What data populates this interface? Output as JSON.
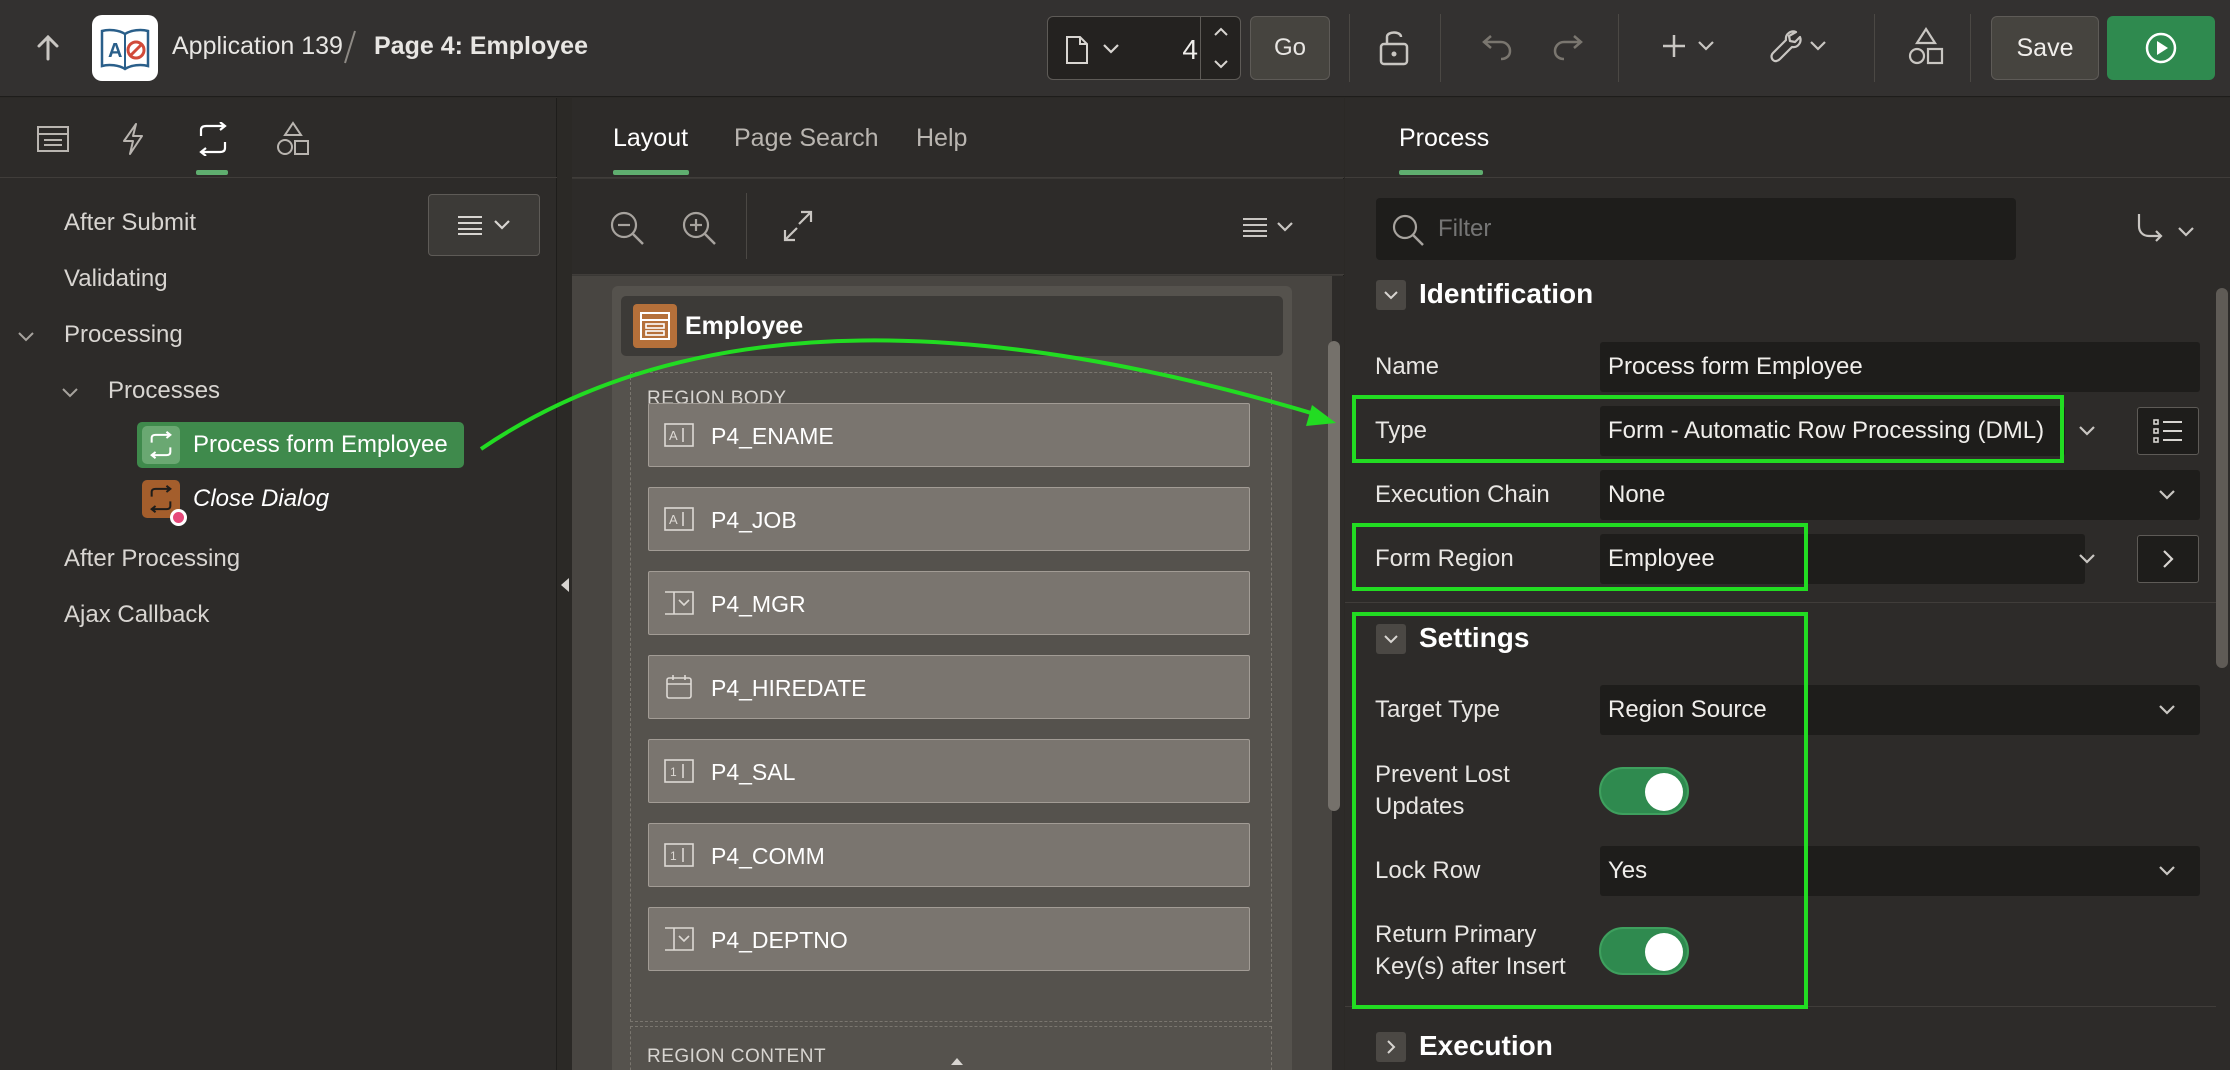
{
  "header": {
    "app_name": "Application 139",
    "page_name": "Page 4: Employee",
    "page_number": "4",
    "go_label": "Go",
    "save_label": "Save"
  },
  "left_panel": {
    "tree": [
      {
        "label": "After Submit"
      },
      {
        "label": "Validating"
      },
      {
        "label": "Processing"
      },
      {
        "label": "Processes"
      },
      {
        "label": "Process form Employee"
      },
      {
        "label": "Close Dialog"
      },
      {
        "label": "After Processing"
      },
      {
        "label": "Ajax Callback"
      }
    ]
  },
  "middle_panel": {
    "tabs": [
      {
        "label": "Layout"
      },
      {
        "label": "Page Search"
      },
      {
        "label": "Help"
      }
    ],
    "region_title": "Employee",
    "region_body_label": "REGION BODY",
    "region_content_label": "REGION CONTENT",
    "fields": [
      {
        "name": "P4_ENAME",
        "icon": "text-field-icon"
      },
      {
        "name": "P4_JOB",
        "icon": "text-field-icon"
      },
      {
        "name": "P4_MGR",
        "icon": "select-list-icon"
      },
      {
        "name": "P4_HIREDATE",
        "icon": "calendar-icon"
      },
      {
        "name": "P4_SAL",
        "icon": "number-field-icon"
      },
      {
        "name": "P4_COMM",
        "icon": "number-field-icon"
      },
      {
        "name": "P4_DEPTNO",
        "icon": "select-list-icon"
      }
    ]
  },
  "right_panel": {
    "tab": "Process",
    "filter_placeholder": "Filter",
    "identification": {
      "title": "Identification",
      "name_label": "Name",
      "name_value": "Process form Employee",
      "type_label": "Type",
      "type_value": "Form - Automatic Row Processing (DML)",
      "chain_label": "Execution Chain",
      "chain_value": "None",
      "form_region_label": "Form Region",
      "form_region_value": "Employee"
    },
    "settings": {
      "title": "Settings",
      "target_type_label": "Target Type",
      "target_type_value": "Region Source",
      "prevent_lost_label_1": "Prevent Lost",
      "prevent_lost_label_2": "Updates",
      "prevent_lost_value": true,
      "lock_row_label": "Lock Row",
      "lock_row_value": "Yes",
      "return_pk_label_1": "Return Primary",
      "return_pk_label_2": "Key(s) after Insert",
      "return_pk_value": true
    },
    "execution_title": "Execution"
  },
  "colors": {
    "accent_green": "#2f8a4f",
    "highlight_green": "#22dc22",
    "region_orange": "#b5703a"
  }
}
